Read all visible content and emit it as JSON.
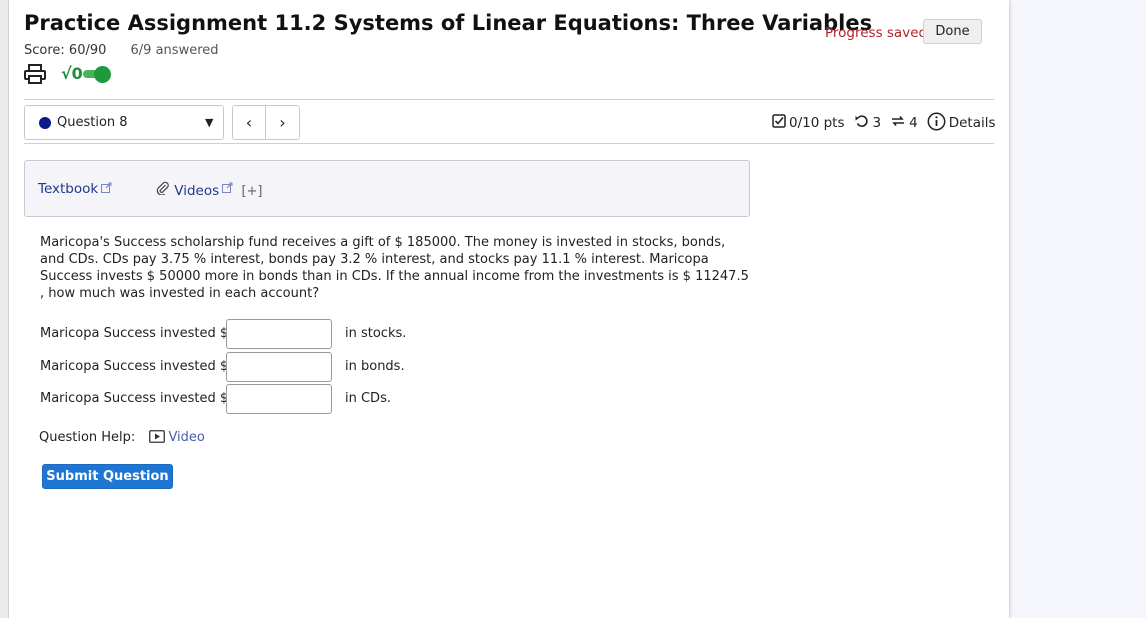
{
  "header": {
    "title": "Practice Assignment 11.2 Systems of Linear Equations: Three Variables",
    "score": "Score: 60/90",
    "answered": "6/9 answered",
    "progress_status": "Progress saved",
    "done_label": "Done",
    "math_toggle_label": "√0",
    "math_toggle_on": true
  },
  "question_nav": {
    "selected": "Question 8",
    "prev_label": "‹",
    "next_label": "›"
  },
  "meta": {
    "points": "0/10 pts",
    "retries": "3",
    "attempts": "4",
    "details_label": "Details"
  },
  "resources": {
    "textbook_label": "Textbook",
    "videos_label": "Videos",
    "expand_label": "[+]"
  },
  "problem": {
    "text": "Maricopa's Success scholarship fund receives a gift of $ 185000. The money is invested in stocks, bonds, and CDs. CDs pay 3.75 % interest, bonds pay 3.2 % interest, and stocks pay 11.1 % interest. Maricopa Success invests $ 50000 more in bonds than in CDs. If the annual income from the investments is $ 11247.5 , how much was invested in each account?"
  },
  "answers": [
    {
      "prefix": "Maricopa Success invested $",
      "value": "",
      "suffix": "in stocks."
    },
    {
      "prefix": "Maricopa Success invested $",
      "value": "",
      "suffix": "in bonds."
    },
    {
      "prefix": "Maricopa Success invested $",
      "value": "",
      "suffix": "in CDs."
    }
  ],
  "help": {
    "label": "Question Help:",
    "video_label": "Video"
  },
  "submit_label": "Submit Question",
  "colors": {
    "accent_blue": "#1f76d2",
    "progress_red": "#b3202a",
    "toggle_green": "#1e9a3a",
    "question_dot": "#0b1a8c"
  }
}
